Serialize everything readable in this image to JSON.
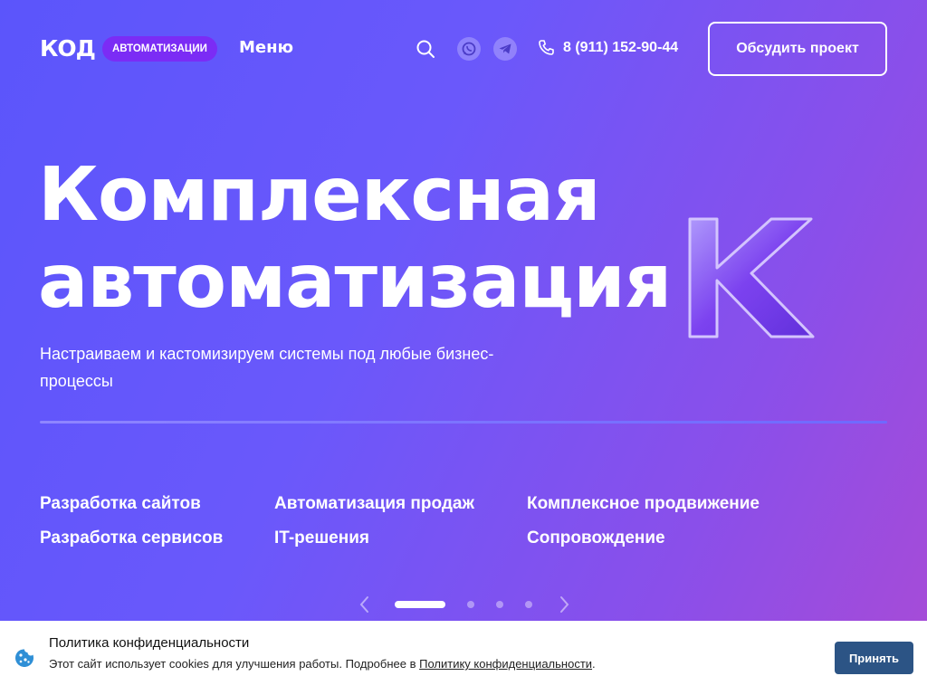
{
  "header": {
    "logo_text": "КОД",
    "logo_badge": "АВТОМАТИЗАЦИИ",
    "menu_label": "Меню",
    "phone": "8 (911) 152-90-44",
    "cta_label": "Обсудить проект",
    "icons": [
      "search-icon",
      "whatsapp-icon",
      "telegram-icon",
      "phone-icon"
    ]
  },
  "hero": {
    "title_line1": "Комплексная",
    "title_line2": "автоматизация",
    "subtitle": "Настраиваем и кастомизируем системы под любые бизнес-процессы",
    "decoration_letter": "К"
  },
  "services": [
    "Разработка сайтов",
    "Автоматизация продаж",
    "Комплексное продвижение",
    "Разработка сервисов",
    "IT-решения",
    "Сопровождение"
  ],
  "slider": {
    "total_slides": 4,
    "active_slide": 1
  },
  "cookie": {
    "title": "Политика конфиденциальности",
    "text": "Этот сайт использует cookies для улучшения работы. Подробнее в ",
    "link": "Политику конфиденциальности",
    "text_end": ".",
    "accept_label": "Принять"
  },
  "colors": {
    "gradient_start": "#5b55fb",
    "gradient_end": "#a84bd6",
    "badge": "#7b2cf5",
    "accept_button": "#2c5485"
  }
}
